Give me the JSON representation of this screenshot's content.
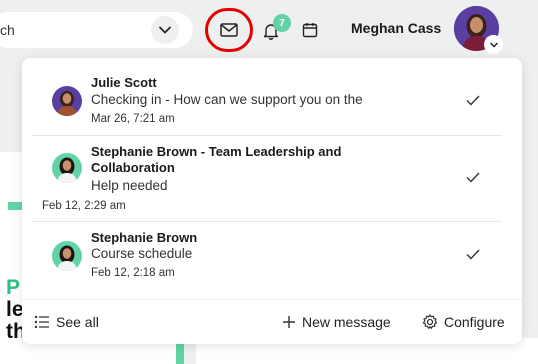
{
  "search": {
    "placeholder": "ch"
  },
  "header": {
    "notifications_badge": "7",
    "user_name": "Meghan Cass"
  },
  "background": {
    "line1": "P",
    "line2": "le",
    "line3": "th"
  },
  "messages": [
    {
      "sender": "Julie Scott",
      "text": "Checking in - How can we support you on the",
      "date": "Mar 26, 7:21 am"
    },
    {
      "sender": "Stephanie Brown - Team Leadership and Collaboration",
      "text": "Help needed",
      "date": "Feb 12, 2:29 am"
    },
    {
      "sender": "Stephanie Brown",
      "text": "Course schedule",
      "date": "Feb 12, 2:18 am"
    }
  ],
  "footer": {
    "see_all": "See all",
    "new_message": "New message",
    "configure": "Configure"
  },
  "colors": {
    "accent": "#61d3a7",
    "highlight_ring": "#e30000",
    "avatar_purple": "#5a3fa3"
  }
}
